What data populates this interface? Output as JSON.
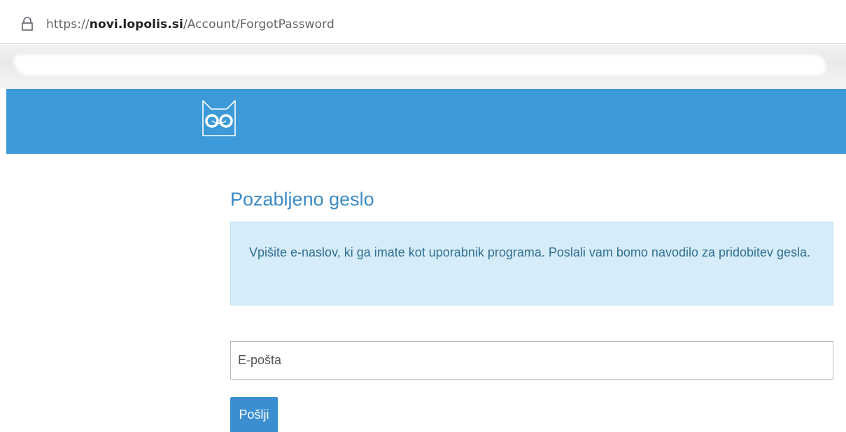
{
  "address_bar": {
    "url_prefix": "https://",
    "url_domain": "novi.lopolis.si",
    "url_path": "/Account/ForgotPassword"
  },
  "page": {
    "title": "Pozabljeno geslo",
    "info_text": "Vpišite e-naslov, ki ga imate kot uporabnik programa. Poslali vam bomo navodilo za pridobitev gesla.",
    "email_placeholder": "E-pošta",
    "submit_label": "Pošlji"
  },
  "colors": {
    "banner": "#3b9ad7",
    "title": "#3b8bc6",
    "info_bg": "#d6ecf8",
    "button": "#3b8fd0"
  },
  "icons": [
    "lock-icon",
    "lopolis-owl-logo"
  ]
}
